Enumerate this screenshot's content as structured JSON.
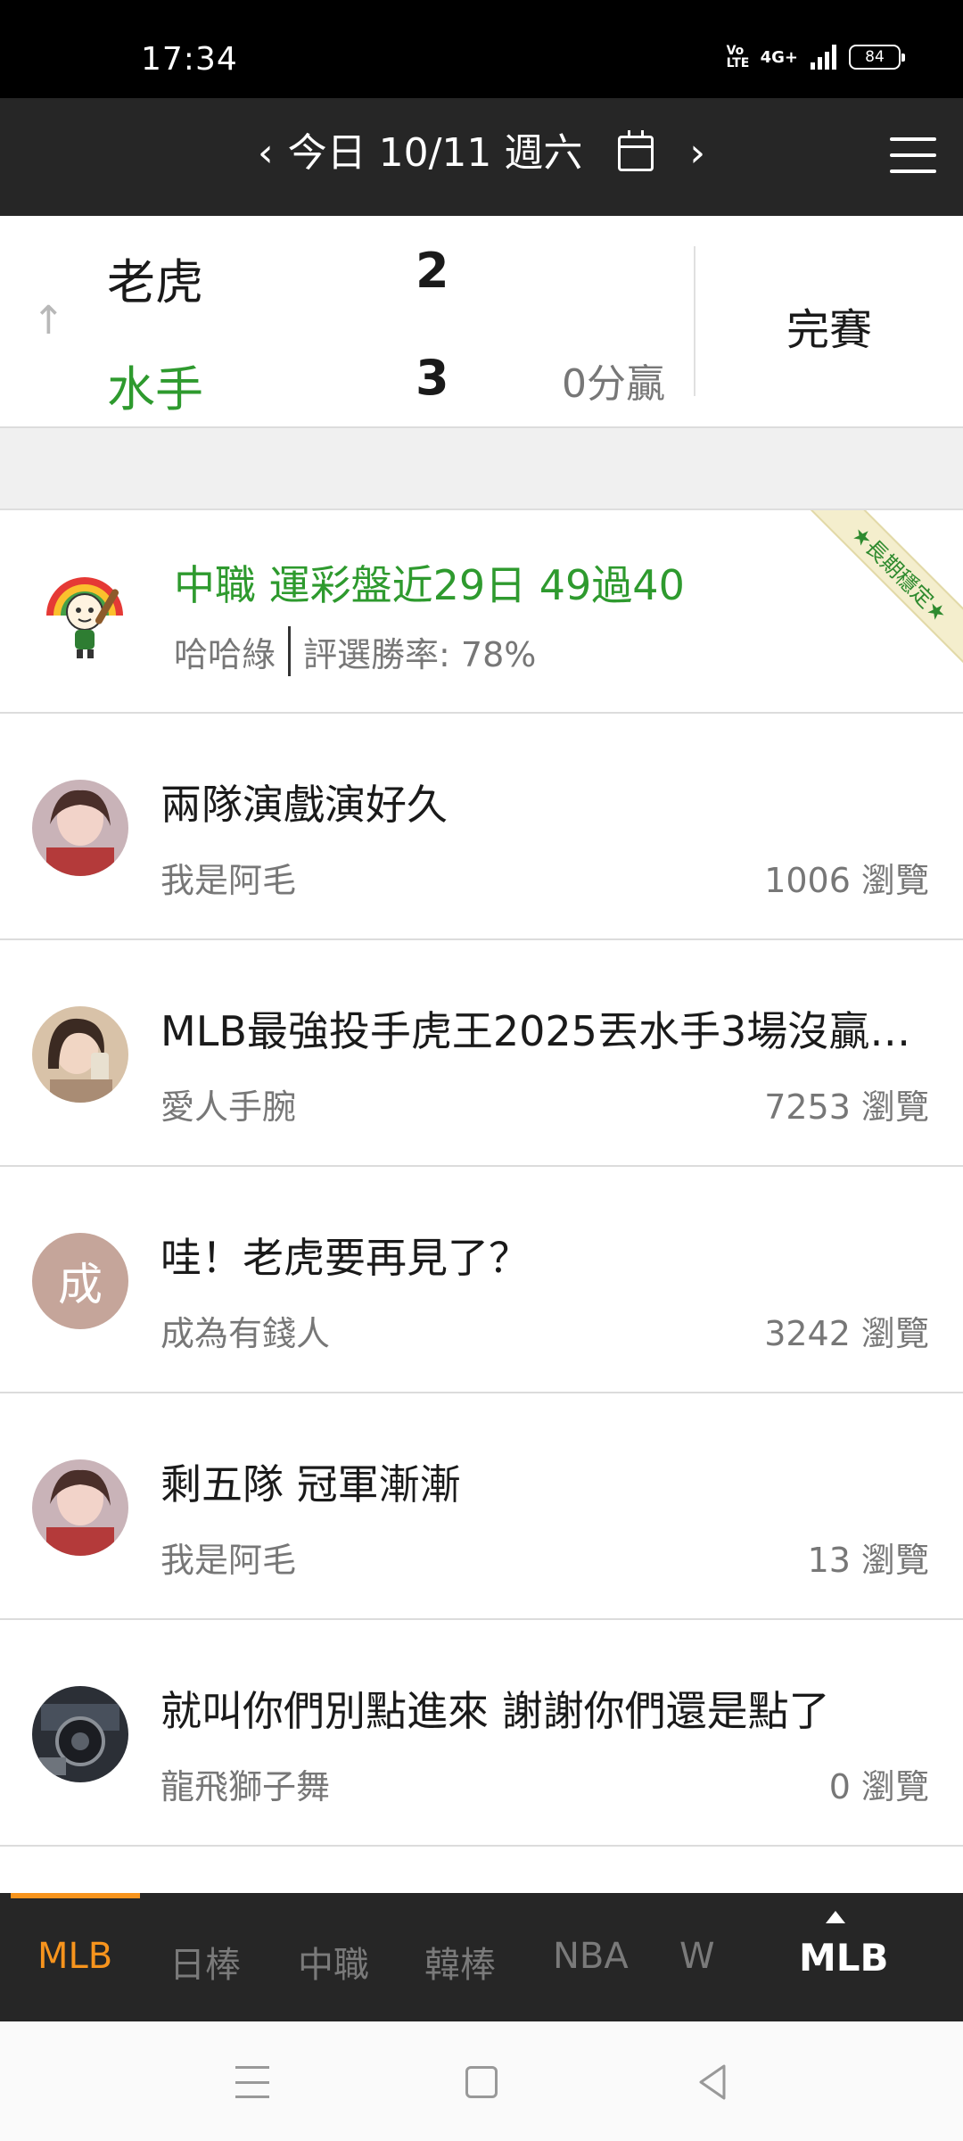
{
  "status_bar": {
    "time": "17:34",
    "volte": "Vo LTE",
    "network": "4G+",
    "battery": "84"
  },
  "nav": {
    "prev": "‹",
    "date": "今日 10/11 週六",
    "next": "›"
  },
  "score": {
    "away_team": "老虎",
    "away_runs": "2",
    "home_team": "水手",
    "home_runs": "3",
    "win_note": "0分贏",
    "status": "完賽",
    "away_color": "#1a1a1a",
    "home_color": "#2e9a2e"
  },
  "promo": {
    "title": "中職 運彩盤近29日 49過40",
    "author": "哈哈綠",
    "rate": "評選勝率: 78%",
    "ribbon": "★長期穩定★"
  },
  "posts": [
    {
      "title": "兩隊演戲演好久",
      "author": "我是阿毛",
      "views": "1006 瀏覽"
    },
    {
      "title": "MLB最強投手虎王2025丟水手3場沒贏…",
      "author": "愛人手腕",
      "views": "7253 瀏覽"
    },
    {
      "title": "哇！老虎要再見了？",
      "author": "成為有錢人",
      "views": "3242 瀏覽",
      "avatar_text": "成"
    },
    {
      "title": "剩五隊 冠軍漸漸",
      "author": "我是阿毛",
      "views": "13 瀏覽"
    },
    {
      "title": "就叫你們別點進來 謝謝你們還是點了",
      "author": "龍飛獅子舞",
      "views": "0 瀏覽"
    }
  ],
  "tabs": {
    "items": [
      "MLB",
      "日棒",
      "中職",
      "韓棒",
      "NBA",
      "W"
    ],
    "current": "MLB",
    "active_color": "#f7941d"
  }
}
